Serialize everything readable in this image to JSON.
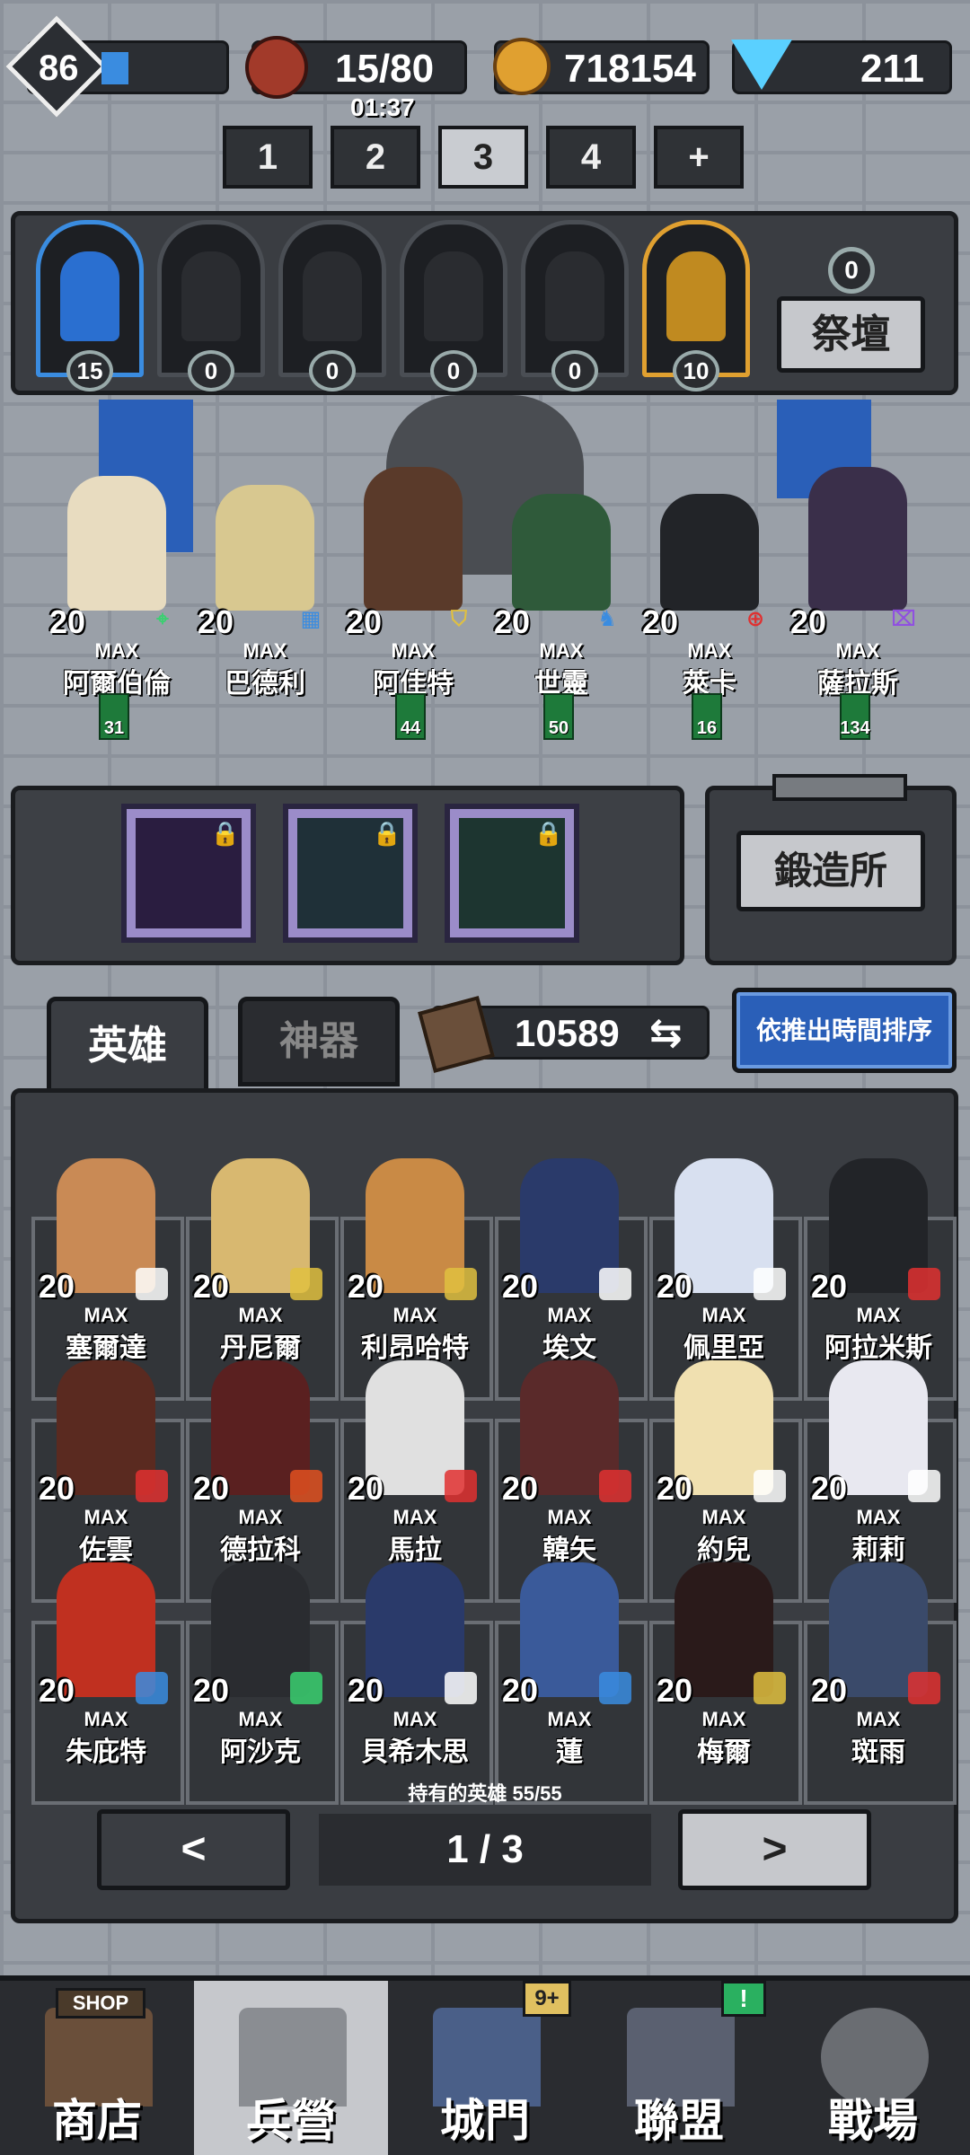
{
  "status": {
    "level": "86",
    "meat": "15/80",
    "meat_timer": "01:37",
    "gold": "718154",
    "gems": "211"
  },
  "team_tabs": [
    "1",
    "2",
    "3",
    "4",
    "+"
  ],
  "active_team_index": 2,
  "altar": {
    "slots": [
      "15",
      "0",
      "0",
      "0",
      "0",
      "10"
    ],
    "count": "0",
    "button": "祭壇"
  },
  "team": [
    {
      "level": "20",
      "max": "MAX",
      "name": "阿爾伯倫",
      "power": "31",
      "icon": "target-icon",
      "color": "#3ad070"
    },
    {
      "level": "20",
      "max": "MAX",
      "name": "巴德利",
      "power": "",
      "icon": "grid-icon",
      "color": "#3a8ce0"
    },
    {
      "level": "20",
      "max": "MAX",
      "name": "阿佳特",
      "power": "44",
      "icon": "shield-icon",
      "color": "#e0c040"
    },
    {
      "level": "20",
      "max": "MAX",
      "name": "世靈",
      "power": "50",
      "icon": "figure-icon",
      "color": "#3a8ce0"
    },
    {
      "level": "20",
      "max": "MAX",
      "name": "萊卡",
      "power": "16",
      "icon": "crosshair-icon",
      "color": "#e03030"
    },
    {
      "level": "20",
      "max": "MAX",
      "name": "薩拉斯",
      "power": "134",
      "icon": "rune-icon",
      "color": "#9050e0"
    }
  ],
  "forge": {
    "button": "鍛造所"
  },
  "tabs": {
    "heroes": "英雄",
    "artifacts": "神器"
  },
  "scrolls": "10589",
  "sort_button": "依推出時間排序",
  "heroes": [
    {
      "level": "20",
      "max": "MAX",
      "name": "塞爾達",
      "color": "#ffffff"
    },
    {
      "level": "20",
      "max": "MAX",
      "name": "丹尼爾",
      "color": "#e0c040"
    },
    {
      "level": "20",
      "max": "MAX",
      "name": "利昂哈特",
      "color": "#e0c040"
    },
    {
      "level": "20",
      "max": "MAX",
      "name": "埃文",
      "color": "#ffffff"
    },
    {
      "level": "20",
      "max": "MAX",
      "name": "佩里亞",
      "color": "#ffffff"
    },
    {
      "level": "20",
      "max": "MAX",
      "name": "阿拉米斯",
      "color": "#e03030"
    },
    {
      "level": "20",
      "max": "MAX",
      "name": "佐雲",
      "color": "#e03030"
    },
    {
      "level": "20",
      "max": "MAX",
      "name": "德拉科",
      "color": "#e05020"
    },
    {
      "level": "20",
      "max": "MAX",
      "name": "馬拉",
      "color": "#e03030"
    },
    {
      "level": "20",
      "max": "MAX",
      "name": "韓矢",
      "color": "#e03030"
    },
    {
      "level": "20",
      "max": "MAX",
      "name": "約兒",
      "color": "#ffffff"
    },
    {
      "level": "20",
      "max": "MAX",
      "name": "莉莉",
      "color": "#ffffff"
    },
    {
      "level": "20",
      "max": "MAX",
      "name": "朱庇特",
      "color": "#3a8ce0"
    },
    {
      "level": "20",
      "max": "MAX",
      "name": "阿沙克",
      "color": "#3ad070"
    },
    {
      "level": "20",
      "max": "MAX",
      "name": "貝希木思",
      "color": "#ffffff"
    },
    {
      "level": "20",
      "max": "MAX",
      "name": "蓮",
      "color": "#3a8ce0"
    },
    {
      "level": "20",
      "max": "MAX",
      "name": "梅爾",
      "color": "#e0c040"
    },
    {
      "level": "20",
      "max": "MAX",
      "name": "斑雨",
      "color": "#e03030"
    }
  ],
  "owned_heroes": "持有的英雄 55/55",
  "pagination": {
    "prev": "<",
    "page": "1 / 3",
    "next": ">"
  },
  "nav": [
    {
      "label": "商店",
      "badge": "SHOP"
    },
    {
      "label": "兵營",
      "badge": ""
    },
    {
      "label": "城門",
      "badge": "9+"
    },
    {
      "label": "聯盟",
      "badge": "!"
    },
    {
      "label": "戰場",
      "badge": ""
    }
  ]
}
